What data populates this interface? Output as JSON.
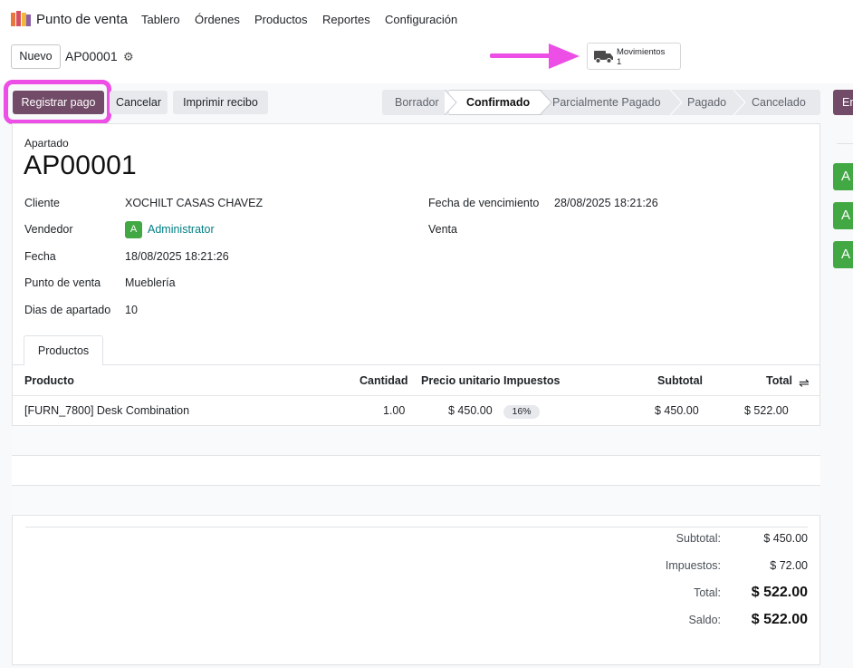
{
  "nav": {
    "app_name": "Punto de venta",
    "menu": [
      "Tablero",
      "Órdenes",
      "Productos",
      "Reportes",
      "Configuración"
    ]
  },
  "control": {
    "new_label": "Nuevo",
    "record_ref": "AP00001",
    "gear_icon": "gear-icon",
    "smart_button": {
      "label": "Movimientos",
      "count": "1",
      "icon": "truck-icon"
    },
    "annotation_color": "#ec4ee6"
  },
  "actions": {
    "pay_label": "Registrar pago",
    "cancel_label": "Cancelar",
    "print_label": "Imprimir recibo",
    "edge_label": "En",
    "primary_color": "#714b67"
  },
  "statusbar": {
    "stages": [
      "Borrador",
      "Confirmado",
      "Parcialmente Pagado",
      "Pagado",
      "Cancelado"
    ],
    "active": "Confirmado"
  },
  "form": {
    "doc_type": "Apartado",
    "title": "AP00001",
    "fields": {
      "cliente": {
        "label": "Cliente",
        "value": "XOCHILT CASAS CHAVEZ"
      },
      "vendedor": {
        "label": "Vendedor",
        "avatar": "A",
        "value": "Administrator"
      },
      "fecha": {
        "label": "Fecha",
        "value": "18/08/2025 18:21:26"
      },
      "punto": {
        "label": "Punto de venta",
        "value": "Mueblería"
      },
      "dias": {
        "label": "Dias de apartado",
        "value": "10"
      },
      "vencimiento": {
        "label": "Fecha de vencimiento",
        "value": "28/08/2025 18:21:26"
      },
      "venta": {
        "label": "Venta",
        "value": ""
      }
    }
  },
  "tabs": [
    "Productos"
  ],
  "table": {
    "headers": [
      "Producto",
      "Cantidad",
      "Precio unitario",
      "Impuestos",
      "Subtotal",
      "Total"
    ],
    "rows": [
      {
        "product": "[FURN_7800] Desk Combination",
        "qty": "1.00",
        "price": "$ 450.00",
        "tax": "16%",
        "subtotal": "$ 450.00",
        "total": "$ 522.00"
      }
    ]
  },
  "totals": {
    "subtotal": {
      "label": "Subtotal:",
      "value": "$ 450.00"
    },
    "taxes": {
      "label": "Impuestos:",
      "value": "$ 72.00"
    },
    "total": {
      "label": "Total:",
      "value": "$ 522.00"
    },
    "balance": {
      "label": "Saldo:",
      "value": "$ 522.00"
    }
  },
  "chatter": {
    "avatars": [
      "A",
      "A",
      "A"
    ]
  }
}
